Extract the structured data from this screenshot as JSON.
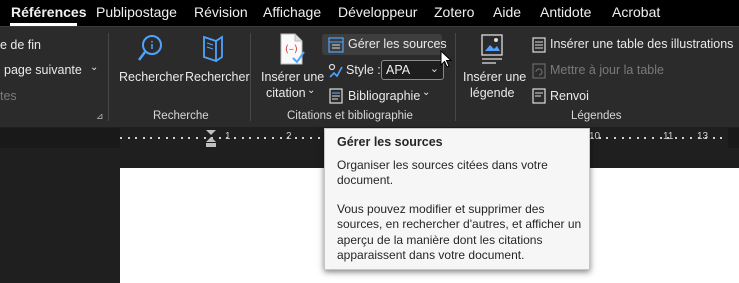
{
  "tabs": [
    "Références",
    "Publipostage",
    "Révision",
    "Affichage",
    "Développeur",
    "Zotero",
    "Aide",
    "Antidote",
    "Acrobat"
  ],
  "ribbon": {
    "partial_left": {
      "line1": "e de fin",
      "line2": "page suivante",
      "line3": "tes"
    },
    "recherche": {
      "btn1": "Rechercher",
      "btn2": "Rechercher",
      "group": "Recherche"
    },
    "citations": {
      "insert_line1": "Insérer une",
      "insert_line2": "citation",
      "manage_sources": "Gérer les sources",
      "style_label": "Style :",
      "style_value": "APA",
      "bibliography": "Bibliographie",
      "group": "Citations et bibliographie"
    },
    "legendes": {
      "insert_line1": "Insérer une",
      "insert_line2": "légende",
      "table_illus": "Insérer une table des illustrations",
      "update_table": "Mettre à jour la table",
      "renvoi": "Renvoi",
      "group": "Légendes"
    }
  },
  "ruler": {
    "n1": "1",
    "n2": "2",
    "n10": "10",
    "n11": "11",
    "n13": "13"
  },
  "tooltip": {
    "title": "Gérer les sources",
    "p1_l1": "Organiser les sources citées dans votre",
    "p1_l2": "document.",
    "p2_l1": "Vous pouvez modifier et supprimer des",
    "p2_l2": "sources, en rechercher d'autres, et afficher un",
    "p2_l3": "aperçu de la manière dont les citations",
    "p2_l4": "apparaissent dans votre document."
  }
}
